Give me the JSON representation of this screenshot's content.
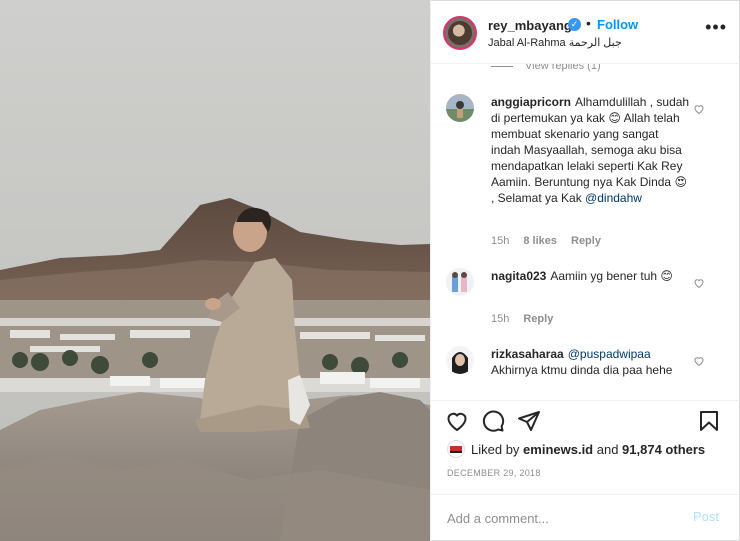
{
  "post": {
    "username": "rey_mbayang",
    "verified_mark": "✓",
    "separator": "•",
    "follow_label": "Follow",
    "location": "Jabal Al-Rahma جبل الرحمة",
    "more_label": "•••"
  },
  "comments": {
    "view_replies": "View replies (1)",
    "items": [
      {
        "username": "anggiapricorn",
        "text": "Alhamdulillah , sudah di pertemukan ya kak 😊 Allah telah membuat skenario yang sangat indah Masyaallah, semoga aku bisa mendapatkan lelaki seperti Kak Rey Aamiin. Beruntung nya Kak Dinda 😍 , Selamat ya Kak ",
        "mention": "@dindahw",
        "time": "15h",
        "likes": "8 likes",
        "reply": "Reply"
      },
      {
        "username": "nagita023",
        "text": "Aamiin yg bener tuh 😊",
        "time": "15h",
        "reply": "Reply"
      },
      {
        "username": "rizkasaharaa",
        "mention": "@puspadwipaa",
        "text": "Akhirnya ktmu dinda dia paa hehe"
      }
    ]
  },
  "likes": {
    "prefix": "Liked by ",
    "liker": "eminews.id",
    "middle": " and ",
    "count": "91,874 others"
  },
  "date": "DECEMBER 29, 2018",
  "add_comment": {
    "placeholder": "Add a comment...",
    "post_label": "Post"
  },
  "colors": {
    "link_blue": "#0095f6",
    "mention": "#00376b",
    "post_disabled": "#b2dffc",
    "muted": "#8e8e8e"
  },
  "icons": [
    "heart-icon",
    "comment-icon",
    "share-icon",
    "save-icon",
    "more-icon",
    "verified-icon"
  ]
}
